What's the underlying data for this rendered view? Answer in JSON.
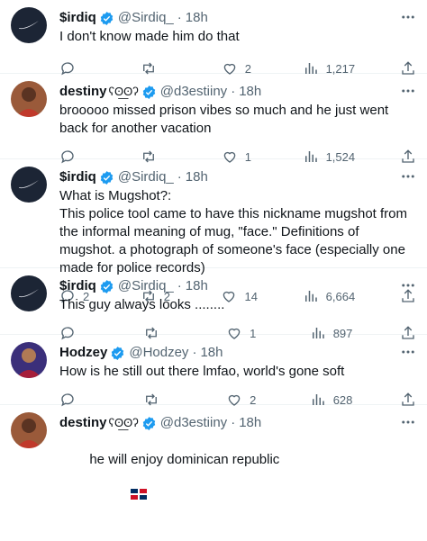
{
  "tweets": [
    {
      "name": "$irdiq",
      "handle": "@Sirdiq_",
      "time": "18h",
      "text": "I don't know made him do that",
      "replies": "",
      "reposts": "",
      "likes": "2",
      "views": "1,217",
      "avatar": "dark-logo"
    },
    {
      "name": "destiny",
      "handle": "@d3estiiny",
      "time": "18h",
      "text": "brooooo missed prison vibes so much and he just went back for another vacation",
      "replies": "",
      "reposts": "",
      "likes": "1",
      "views": "1,524",
      "avatar": "person"
    },
    {
      "name": "$irdiq",
      "handle": "@Sirdiq_",
      "time": "18h",
      "text": "What is Mugshot?:\nThis police tool came to have this nickname mugshot from the informal meaning of mug, \"face.\" Definitions of mugshot. a photograph of someone's face (especially one made for police records)",
      "replies": "2",
      "reposts": "2",
      "likes": "14",
      "views": "6,664",
      "avatar": "dark-logo"
    },
    {
      "name": "$irdiq",
      "handle": "@Sirdiq_",
      "time": "18h",
      "text": "This guy always looks ........",
      "replies": "",
      "reposts": "",
      "likes": "1",
      "views": "897",
      "avatar": "dark-logo"
    },
    {
      "name": "Hodzey",
      "handle": "@Hodzey",
      "time": "18h",
      "text": "How is he still out there lmfao, world's gone soft",
      "replies": "",
      "reposts": "",
      "likes": "2",
      "views": "628",
      "avatar": "person"
    },
    {
      "name": "destiny",
      "handle": "@d3estiiny",
      "time": "18h",
      "text": "he will enjoy dominican republic",
      "avatar": "person"
    }
  ],
  "colors": {
    "muted": "#536471",
    "verified": "#1d9bf0",
    "border": "#eff3f4"
  }
}
